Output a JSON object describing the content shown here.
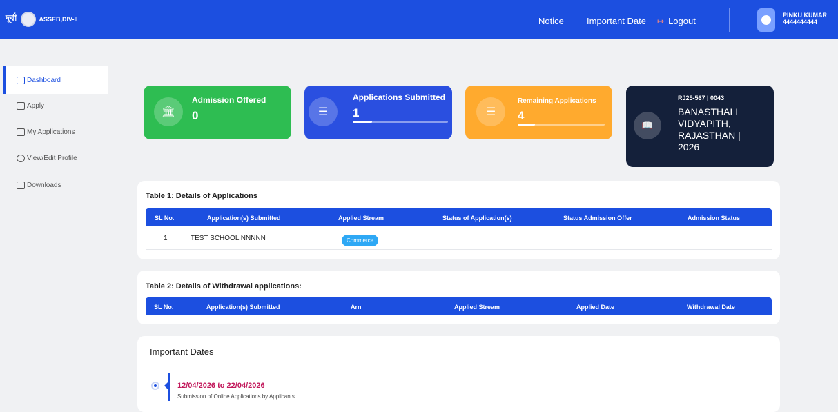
{
  "brand": {
    "script": "দূর্বা",
    "name": "ASSEB,DIV-II"
  },
  "topnav": {
    "notice": "Notice",
    "important_date": "Important Date",
    "logout": "Logout",
    "logout_icon": "↦"
  },
  "user": {
    "name": "PINKU KUMAR",
    "id": "4444444444"
  },
  "sidebar": {
    "items": [
      {
        "label": "Dashboard",
        "icon": "home-icon"
      },
      {
        "label": "Apply",
        "icon": "form-icon"
      },
      {
        "label": "My Applications",
        "icon": "folder-icon"
      },
      {
        "label": "View/Edit Profile",
        "icon": "profile-icon"
      },
      {
        "label": "Downloads",
        "icon": "download-icon"
      }
    ]
  },
  "cards": {
    "admission": {
      "title": "Admission Offered",
      "value": "0",
      "color": "#2ebd52",
      "icon": "🏛"
    },
    "submitted": {
      "title": "Applications Submitted",
      "value": "1",
      "progress": 0.2,
      "color": "#2a4fe0",
      "icon": "☰"
    },
    "remaining": {
      "title": "Remaining Applications",
      "value": "4",
      "progress": 0.2,
      "color": "#ffaa2e",
      "icon": "☰"
    },
    "school": {
      "code": "RJ25-567 | 0043",
      "name": "BANASTHALI VIDYAPITH, RAJASTHAN | 2026",
      "color": "#14203a",
      "icon": "📖"
    }
  },
  "table1": {
    "title": "Table 1: Details of Applications",
    "headers": [
      "SL No.",
      "Application(s) Submitted",
      "Applied Stream",
      "Status of Application(s)",
      "Status Admission Offer",
      "Admission Status"
    ],
    "rows": [
      {
        "sl": "1",
        "app": "TEST SCHOOL NNNNN",
        "stream": "Commerce"
      }
    ]
  },
  "table2": {
    "title": "Table 2: Details of Withdrawal applications:",
    "headers": [
      "SL No.",
      "Application(s) Submitted",
      "Arn",
      "Applied Stream",
      "Applied Date",
      "Withdrawal Date"
    ]
  },
  "important": {
    "title": "Important Dates",
    "items": [
      {
        "date": "12/04/2026 to 22/04/2026",
        "desc": "Submission of Online Applications by Applicants."
      }
    ]
  }
}
